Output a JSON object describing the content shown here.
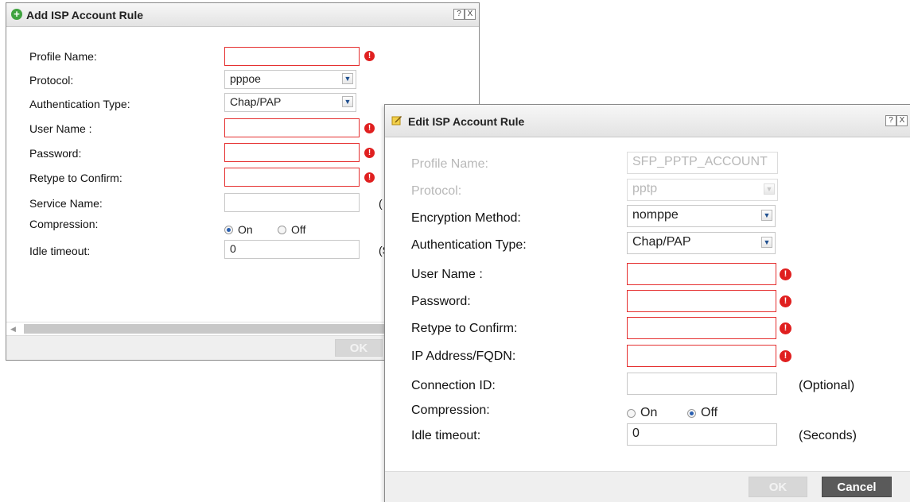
{
  "add_dialog": {
    "title": "Add ISP Account Rule",
    "help_glyph": "?",
    "close_glyph": "X",
    "labels": {
      "profile_name": "Profile Name:",
      "protocol": "Protocol:",
      "auth_type": "Authentication Type:",
      "user_name": "User Name :",
      "password": "Password:",
      "retype": "Retype to Confirm:",
      "service_name": "Service Name:",
      "compression": "Compression:",
      "idle_timeout": "Idle timeout:"
    },
    "values": {
      "profile_name": "",
      "protocol": "pppoe",
      "auth_type": "Chap/PAP",
      "user_name": "",
      "password": "",
      "retype": "",
      "service_name": "",
      "idle_timeout": "0"
    },
    "compression": {
      "on_label": "On",
      "off_label": "Off",
      "selected": "On"
    },
    "truncated_suffix_service": "(",
    "truncated_suffix_idle": "(S",
    "ok_label": "OK"
  },
  "edit_dialog": {
    "title": "Edit ISP Account Rule",
    "help_glyph": "?",
    "close_glyph": "X",
    "labels": {
      "profile_name": "Profile Name:",
      "protocol": "Protocol:",
      "encryption": "Encryption Method:",
      "auth_type": "Authentication Type:",
      "user_name": "User Name :",
      "password": "Password:",
      "retype": "Retype to Confirm:",
      "ip_address": "IP Address/FQDN:",
      "connection_id": "Connection ID:",
      "compression": "Compression:",
      "idle_timeout": "Idle timeout:"
    },
    "values": {
      "profile_name": "SFP_PPTP_ACCOUNT",
      "protocol": "pptp",
      "encryption": "nomppe",
      "auth_type": "Chap/PAP",
      "user_name": "",
      "password": "",
      "retype": "",
      "ip_address": "",
      "connection_id": "",
      "idle_timeout": "0"
    },
    "compression": {
      "on_label": "On",
      "off_label": "Off",
      "selected": "Off"
    },
    "optional_note": "(Optional)",
    "seconds_note": "(Seconds)",
    "ok_label": "OK",
    "cancel_label": "Cancel"
  },
  "icons": {
    "warning": "!",
    "dropdown_arrow": "▼",
    "scroll_left": "◀"
  },
  "colors": {
    "required_border": "#e53030",
    "warning": "#e02020",
    "add_icon": "#3fa33f",
    "cancel_button": "#5a5a5a"
  }
}
